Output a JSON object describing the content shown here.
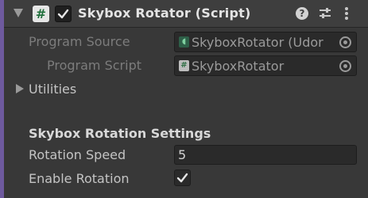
{
  "header": {
    "title": "Skybox Rotator (Script)",
    "script_icon_glyph": "#",
    "enabled": true,
    "icons": [
      "fold-arrow-icon",
      "script-icon",
      "checkbox-icon",
      "help-icon",
      "presets-icon",
      "menu-icon"
    ]
  },
  "fields": {
    "program_source": {
      "label": "Program Source",
      "value": "SkyboxRotator (Udor"
    },
    "program_script": {
      "label": "Program Script",
      "value": "SkyboxRotator",
      "icon_glyph": "#"
    }
  },
  "utilities": {
    "label": "Utilities"
  },
  "settings": {
    "section_title": "Skybox Rotation Settings",
    "rotation_speed": {
      "label": "Rotation Speed",
      "value": "5"
    },
    "enable_rotation": {
      "label": "Enable Rotation",
      "checked": true
    }
  },
  "colors": {
    "panel_bg": "#383838",
    "header_bg": "#3e3e3e",
    "accent_bar": "#6e5a9e",
    "field_bg": "#2a2a2a",
    "text": "#c4c4c4"
  }
}
